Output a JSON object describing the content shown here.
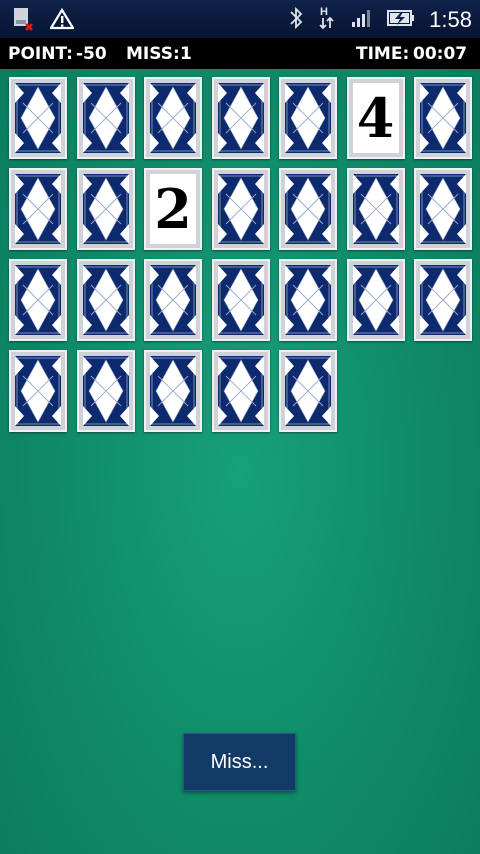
{
  "status_bar": {
    "time": "1:58",
    "icons": [
      "sd-card-error-icon",
      "warning-icon",
      "bluetooth-icon",
      "hspa-data-icon",
      "signal-icon",
      "battery-charging-icon"
    ]
  },
  "hud": {
    "point_label": "POINT:",
    "point_value": "-50",
    "miss_label": "MISS:",
    "miss_value": "1",
    "time_label": "TIME:",
    "time_value": "00:07"
  },
  "board": {
    "cards": [
      {
        "face": "down"
      },
      {
        "face": "down"
      },
      {
        "face": "down"
      },
      {
        "face": "down"
      },
      {
        "face": "down"
      },
      {
        "face": "up",
        "value": "4"
      },
      {
        "face": "down"
      },
      {
        "face": "down"
      },
      {
        "face": "down"
      },
      {
        "face": "up",
        "value": "2"
      },
      {
        "face": "down"
      },
      {
        "face": "down"
      },
      {
        "face": "down"
      },
      {
        "face": "down"
      },
      {
        "face": "down"
      },
      {
        "face": "down"
      },
      {
        "face": "down"
      },
      {
        "face": "down"
      },
      {
        "face": "down"
      },
      {
        "face": "down"
      },
      {
        "face": "down"
      },
      {
        "face": "down"
      },
      {
        "face": "down"
      },
      {
        "face": "down"
      },
      {
        "face": "down"
      },
      {
        "face": "down"
      }
    ],
    "card_back_colors": {
      "primary": "#0d2a6e",
      "secondary": "#ffffff",
      "line": "#9aa9c9"
    }
  },
  "toast": {
    "text": "Miss..."
  }
}
